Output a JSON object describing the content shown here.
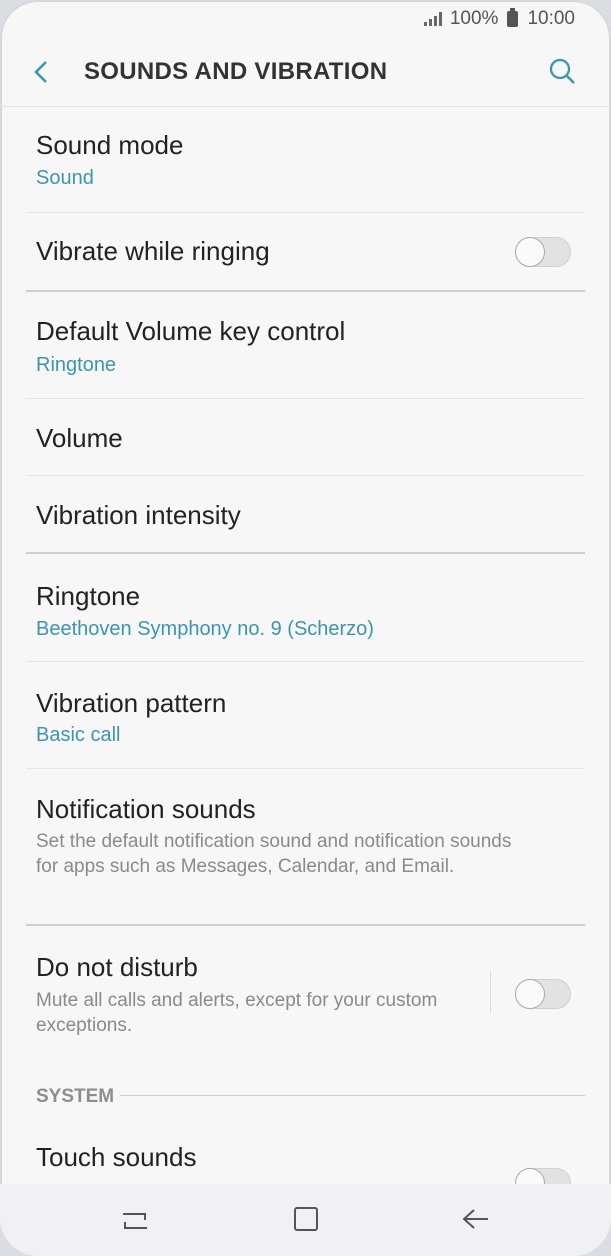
{
  "status_bar": {
    "battery": "100%",
    "time": "10:00"
  },
  "app_bar": {
    "title": "SOUNDS AND VIBRATION"
  },
  "items": {
    "sound_mode": {
      "label": "Sound mode",
      "value": "Sound"
    },
    "vibrate_ringing": {
      "label": "Vibrate while ringing",
      "enabled": false
    },
    "volume_key": {
      "label": "Default Volume key control",
      "value": "Ringtone"
    },
    "volume": {
      "label": "Volume"
    },
    "vibration_intensity": {
      "label": "Vibration intensity"
    },
    "ringtone": {
      "label": "Ringtone",
      "value": "Beethoven Symphony no. 9 (Scherzo)"
    },
    "vibration_pattern": {
      "label": "Vibration pattern",
      "value": "Basic call"
    },
    "notification_sounds": {
      "label": "Notification sounds",
      "description": "Set the default notification sound and notification sounds for apps such as Messages, Calendar, and Email."
    },
    "do_not_disturb": {
      "label": "Do not disturb",
      "description": "Mute all calls and alerts, except for your custom exceptions.",
      "enabled": false
    },
    "touch_sounds": {
      "label": "Touch sounds",
      "enabled": false
    }
  },
  "section_system": {
    "label": "SYSTEM"
  },
  "colors": {
    "accent": "#3c95b0",
    "background": "#f7f7f7"
  },
  "nav": {
    "icons": [
      "recents-icon",
      "home-icon",
      "back-arrow-icon"
    ]
  }
}
